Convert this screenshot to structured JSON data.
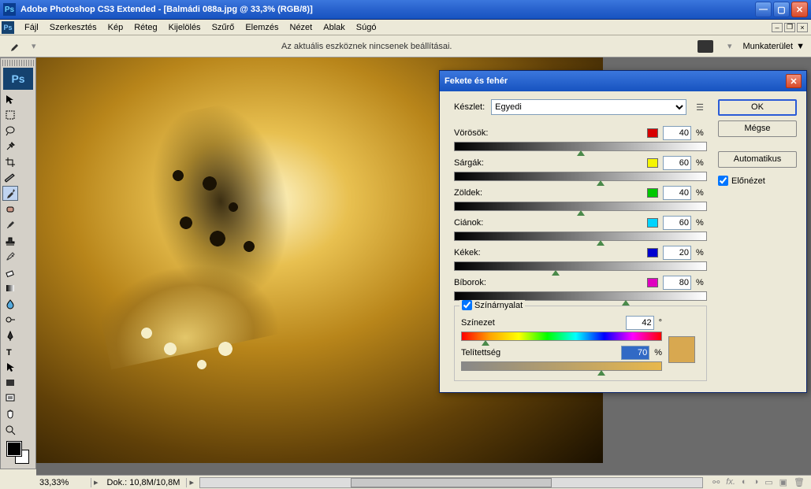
{
  "titlebar": {
    "title": "Adobe Photoshop CS3 Extended - [Balmádi 088a.jpg @ 33,3% (RGB/8)]"
  },
  "menubar": {
    "items": [
      "Fájl",
      "Szerkesztés",
      "Kép",
      "Réteg",
      "Kijelölés",
      "Szűrő",
      "Elemzés",
      "Nézet",
      "Ablak",
      "Súgó"
    ]
  },
  "optbar": {
    "message": "Az aktuális eszköznek nincsenek beállításai.",
    "workspace_label": "Munkaterület"
  },
  "statusbar": {
    "zoom": "33,33%",
    "docinfo": "Dok.: 10,8M/10,8M"
  },
  "dialog": {
    "title": "Fekete és fehér",
    "preset_label": "Készlet:",
    "preset_value": "Egyedi",
    "channels": [
      {
        "label": "Vörösök:",
        "color": "#d80000",
        "value": "40",
        "pos": 50
      },
      {
        "label": "Sárgák:",
        "color": "#f5f500",
        "value": "60",
        "pos": 58
      },
      {
        "label": "Zöldek:",
        "color": "#00c800",
        "value": "40",
        "pos": 50
      },
      {
        "label": "Ciánok:",
        "color": "#00d4ff",
        "value": "60",
        "pos": 58
      },
      {
        "label": "Kékek:",
        "color": "#0000d0",
        "value": "20",
        "pos": 40
      },
      {
        "label": "Bíborok:",
        "color": "#e000c0",
        "value": "80",
        "pos": 68
      }
    ],
    "tint_checkbox": "Színárnyalat",
    "hue_label": "Színezet",
    "hue_value": "42",
    "hue_unit": "°",
    "sat_label": "Telítettség",
    "sat_value": "70",
    "pct": "%",
    "buttons": {
      "ok": "OK",
      "cancel": "Mégse",
      "auto": "Automatikus",
      "preview": "Előnézet"
    }
  }
}
